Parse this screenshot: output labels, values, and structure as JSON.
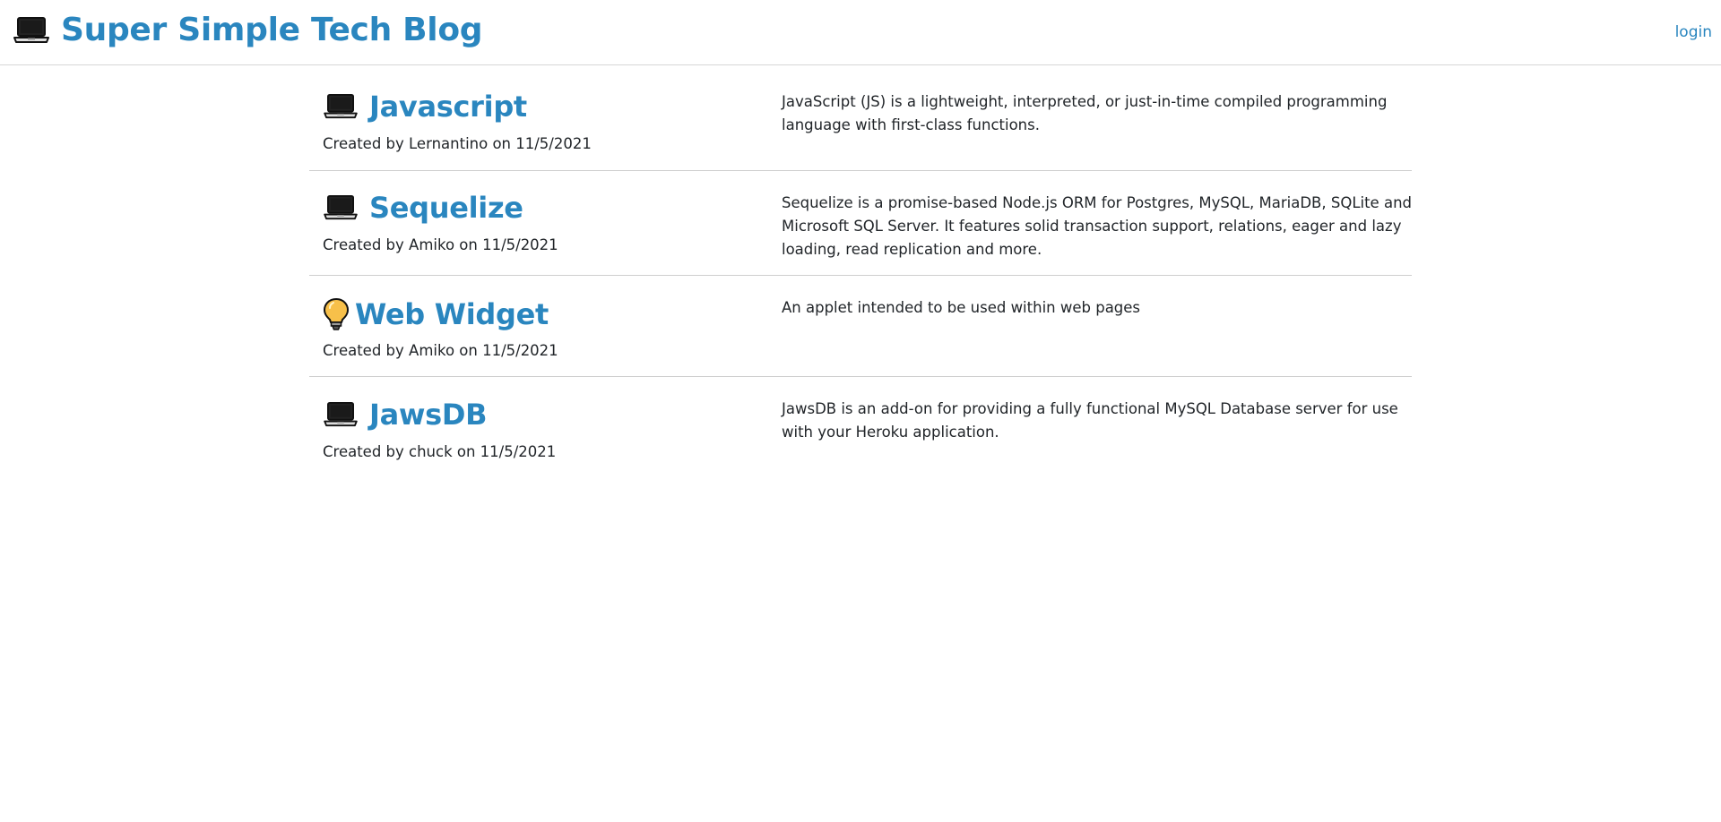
{
  "header": {
    "brand_icon": "laptop-icon",
    "title": "Super Simple Tech Blog",
    "login_label": "login",
    "accent_color": "#2a86bf"
  },
  "posts": [
    {
      "icon": "laptop-icon",
      "title": "Javascript",
      "meta": "Created by Lernantino on 11/5/2021",
      "description": "JavaScript (JS) is a lightweight, interpreted, or just-in-time compiled programming language with first-class functions."
    },
    {
      "icon": "laptop-icon",
      "title": "Sequelize",
      "meta": "Created by Amiko on 11/5/2021",
      "description": "Sequelize is a promise-based Node.js ORM for Postgres, MySQL, MariaDB, SQLite and Microsoft SQL Server. It features solid transaction support, relations, eager and lazy loading, read replication and more."
    },
    {
      "icon": "lightbulb-icon",
      "title": "Web Widget",
      "meta": "Created by Amiko on 11/5/2021",
      "description": "An applet intended to be used within web pages"
    },
    {
      "icon": "laptop-icon",
      "title": "JawsDB",
      "meta": "Created by chuck on 11/5/2021",
      "description": "JawsDB is an add-on for providing a fully functional MySQL Database server for use with your Heroku application."
    }
  ]
}
